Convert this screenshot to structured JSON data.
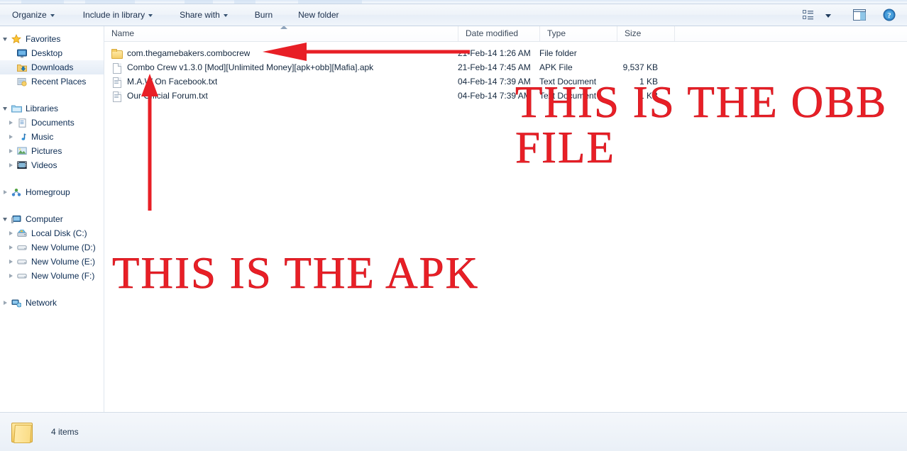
{
  "window": {
    "title": "Downloads",
    "accent_red": "#e81f26",
    "selection_blue": "#e4ecf6"
  },
  "toolbar": {
    "items": [
      {
        "label": "Organize",
        "has_menu": true
      },
      {
        "label": "Include in library",
        "has_menu": true
      },
      {
        "label": "Share with",
        "has_menu": true
      },
      {
        "label": "Burn",
        "has_menu": false
      },
      {
        "label": "New folder",
        "has_menu": false
      }
    ],
    "right_icons": [
      {
        "name": "change-view-icon",
        "glyph": "view-list"
      },
      {
        "name": "view-dropdown-icon",
        "glyph": "caret-down"
      },
      {
        "name": "preview-pane-icon",
        "glyph": "pane"
      },
      {
        "name": "help-icon",
        "glyph": "question"
      }
    ]
  },
  "navpane": {
    "groups": [
      {
        "name": "Favorites",
        "icon": "star-icon",
        "expanded": true,
        "items": [
          {
            "label": "Desktop",
            "icon": "desktop-icon",
            "selected": false,
            "expandable": false
          },
          {
            "label": "Downloads",
            "icon": "downloads-folder-icon",
            "selected": true,
            "expandable": false
          },
          {
            "label": "Recent Places",
            "icon": "recent-places-icon",
            "selected": false,
            "expandable": false
          }
        ]
      },
      {
        "name": "Libraries",
        "icon": "libraries-icon",
        "expanded": true,
        "items": [
          {
            "label": "Documents",
            "icon": "documents-icon",
            "selected": false,
            "expandable": true
          },
          {
            "label": "Music",
            "icon": "music-icon",
            "selected": false,
            "expandable": true
          },
          {
            "label": "Pictures",
            "icon": "pictures-icon",
            "selected": false,
            "expandable": true
          },
          {
            "label": "Videos",
            "icon": "videos-icon",
            "selected": false,
            "expandable": true
          }
        ]
      },
      {
        "name": "Homegroup",
        "icon": "homegroup-icon",
        "expanded": false,
        "items": []
      },
      {
        "name": "Computer",
        "icon": "computer-icon",
        "expanded": true,
        "items": [
          {
            "label": "Local Disk (C:)",
            "icon": "system-drive-icon",
            "selected": false,
            "expandable": true
          },
          {
            "label": "New Volume  (D:)",
            "icon": "drive-icon",
            "selected": false,
            "expandable": true
          },
          {
            "label": "New Volume (E:)",
            "icon": "drive-icon",
            "selected": false,
            "expandable": true
          },
          {
            "label": "New Volume (F:)",
            "icon": "drive-icon",
            "selected": false,
            "expandable": true
          }
        ]
      },
      {
        "name": "Network",
        "icon": "network-icon",
        "expanded": false,
        "items": []
      }
    ]
  },
  "filelist": {
    "columns": [
      {
        "key": "name",
        "label": "Name",
        "sorted": "ascending"
      },
      {
        "key": "date",
        "label": "Date modified",
        "sorted": ""
      },
      {
        "key": "type",
        "label": "Type",
        "sorted": ""
      },
      {
        "key": "size",
        "label": "Size",
        "sorted": ""
      }
    ],
    "rows": [
      {
        "name": "com.thegamebakers.combocrew",
        "date": "21-Feb-14 1:26 AM",
        "type": "File folder",
        "size": "",
        "icon": "folder-icon"
      },
      {
        "name": "Combo Crew v1.3.0 [Mod][Unlimited Money][apk+obb][Mafia].apk",
        "date": "21-Feb-14 7:45 AM",
        "type": "APK File",
        "size": "9,537 KB",
        "icon": "apk-file-icon"
      },
      {
        "name": "M.A.W On Facebook.txt",
        "date": "04-Feb-14 7:39 AM",
        "type": "Text Document",
        "size": "1 KB",
        "icon": "text-file-icon"
      },
      {
        "name": "Our Official Forum.txt",
        "date": "04-Feb-14 7:39 AM",
        "type": "Text Document",
        "size": "1 KB",
        "icon": "text-file-icon"
      }
    ]
  },
  "statusbar": {
    "icon": "folder-icon",
    "item_count_text": "4 items"
  },
  "annotations": {
    "obb_text": "THIS IS THE OBB FILE",
    "apk_text": "THIS IS THE APK",
    "arrow_color": "#e81f26",
    "arrow_to_folder": "points left at the com.thegamebakers.combocrew folder row",
    "arrow_to_apk": "points up at the Combo Crew apk row"
  }
}
